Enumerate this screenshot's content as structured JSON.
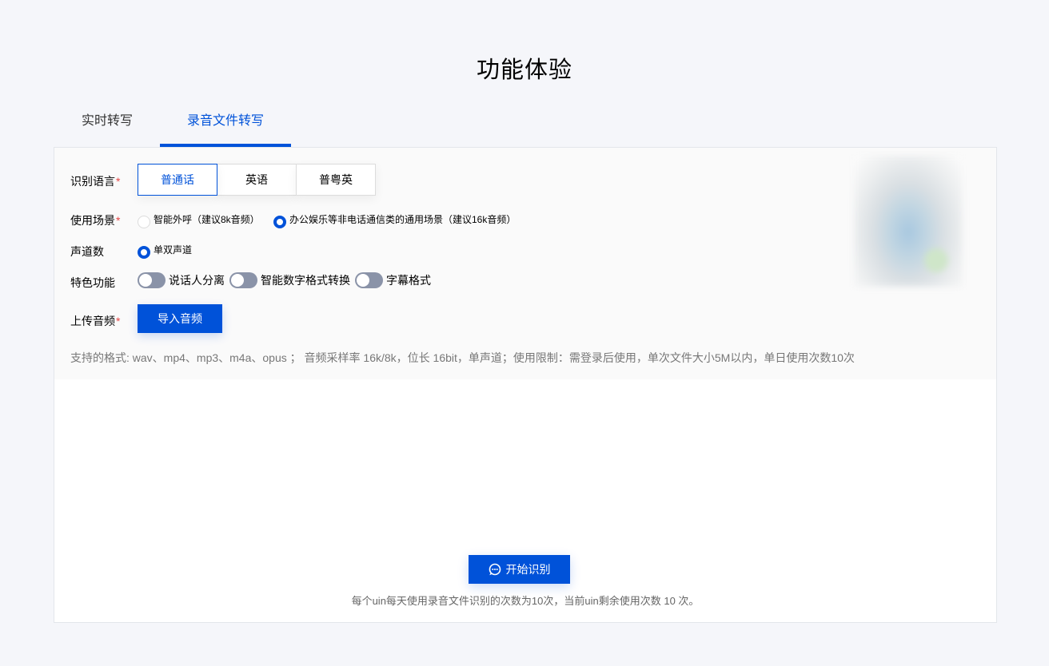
{
  "page": {
    "title": "功能体验"
  },
  "tabs": [
    {
      "label": "实时转写",
      "active": false
    },
    {
      "label": "录音文件转写",
      "active": true
    }
  ],
  "form": {
    "language": {
      "label": "识别语言",
      "required_mark": "*",
      "options": [
        "普通话",
        "英语",
        "普粤英"
      ],
      "selected": "普通话"
    },
    "scene": {
      "label": "使用场景",
      "required_mark": "*",
      "options": [
        {
          "label": "智能外呼（建议8k音频）",
          "checked": false
        },
        {
          "label": "办公娱乐等非电话通信类的通用场景（建议16k音频）",
          "checked": true
        }
      ]
    },
    "channels": {
      "label": "声道数",
      "options": [
        {
          "label": "单双声道",
          "checked": true
        }
      ]
    },
    "features": {
      "label": "特色功能",
      "switches": [
        {
          "label": "说话人分离",
          "on": false
        },
        {
          "label": "智能数字格式转换",
          "on": false
        },
        {
          "label": "字幕格式",
          "on": false
        }
      ]
    },
    "upload": {
      "label": "上传音频",
      "required_mark": "*",
      "button_label": "导入音频"
    },
    "format_hint": "支持的格式: wav、mp4、mp3、m4a、opus ； 音频采样率 16k/8k，位长 16bit，单声道；使用限制：需登录后使用，单次文件大小5M以内，单日使用次数10次"
  },
  "action": {
    "start_label": "开始识别",
    "start_icon": "chat-bubble-icon",
    "usage_hint": "每个uin每天使用录音文件识别的次数为10次，当前uin剩余使用次数 10 次。"
  },
  "colors": {
    "accent": "#0052d9",
    "background": "#f5f6fa",
    "switch_off": "#8a93a8",
    "required": "#e54545"
  }
}
